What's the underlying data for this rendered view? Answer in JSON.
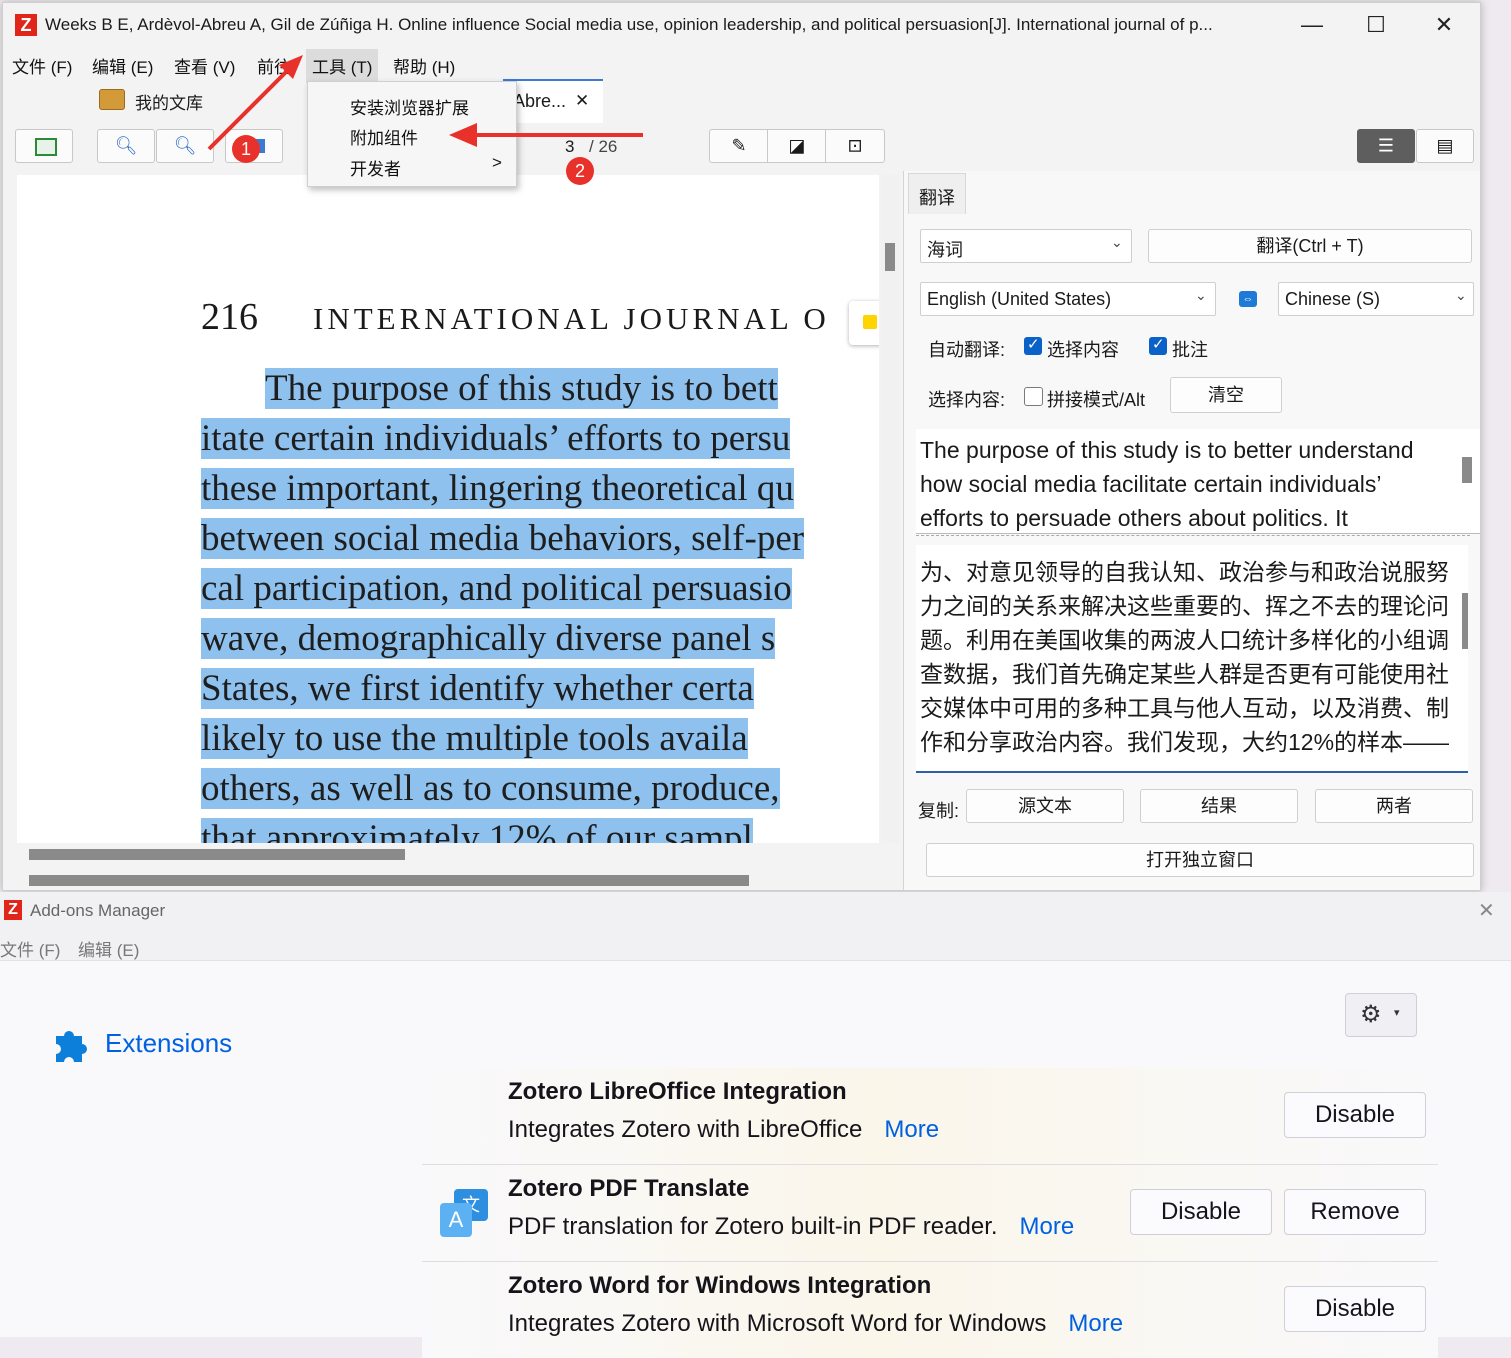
{
  "main_window": {
    "title": "Weeks B E, Ardèvol-Abreu A, Gil de Zúñiga H. Online influence Social media use, opinion leadership, and political persuasion[J]. International journal of p...",
    "logo": "Z",
    "controls": {
      "minimize": "—",
      "maximize": "☐",
      "close": "✕"
    }
  },
  "menubar": {
    "file": "文件 (F)",
    "edit": "编辑 (E)",
    "view": "查看 (V)",
    "go": "前往",
    "tools": "工具 (T)",
    "help": "帮助 (H)"
  },
  "tools_menu": {
    "items": [
      "安装浏览器扩展",
      "附加组件",
      "开发者"
    ],
    "submenu_arrow": ">"
  },
  "tabs": {
    "library": "我的文库",
    "reader_tab": "Abre...",
    "close": "✕"
  },
  "toolbar": {
    "page_current": "3",
    "page_total": "/ 26"
  },
  "annotations": {
    "badge1": "1",
    "badge2": "2"
  },
  "pdf": {
    "header_page": "216",
    "header_journal": "INTERNATIONAL JOURNAL O",
    "lines": [
      "The purpose of this study is to bett",
      "itate certain individuals’ efforts to persu",
      "these important, lingering theoretical qu",
      "between social media behaviors, self-per",
      "cal participation, and political persuasio",
      "wave, demographically diverse panel s",
      "States, we first identify whether certa",
      "likely to use the multiple tools availa",
      "others, as well as to consume, produce,",
      "that approximately 12% of our sampl"
    ]
  },
  "translate_panel": {
    "tab": "翻译",
    "engine": "海词",
    "translate_button": "翻译(Ctrl + T)",
    "source_lang": "English (United States)",
    "target_lang": "Chinese (S)",
    "auto_translate_label": "自动翻译:",
    "auto_selection": "选择内容",
    "auto_annotation": "批注",
    "selection_label": "选择内容:",
    "concat_mode": "拼接模式/Alt",
    "clear": "清空",
    "source_text": [
      "The purpose of this study is to better understand",
      "how social media facilitate certain individuals’",
      "efforts to persuade others about politics. It"
    ],
    "result_text": [
      "为、对意见领导的自我认知、政治参与和政治说服努",
      "力之间的关系来解决这些重要的、挥之不去的理论问",
      "题。利用在美国收集的两波人口统计多样化的小组调",
      "查数据，我们首先确定某些人群是否更有可能使用社",
      "交媒体中可用的多种工具与他人互动，以及消费、制",
      "作和分享政治内容。我们发现，大约12%的样本——"
    ],
    "copy_label": "复制:",
    "copy_source": "源文本",
    "copy_result": "结果",
    "copy_both": "两者",
    "open_window": "打开独立窗口"
  },
  "addons": {
    "title": "Add-ons Manager",
    "menu": {
      "file": "文件 (F)",
      "edit": "编辑 (E)"
    },
    "category": "Extensions",
    "items": [
      {
        "name": "Zotero LibreOffice Integration",
        "desc": "Integrates Zotero with LibreOffice",
        "more": "More",
        "buttons": [
          "Disable"
        ]
      },
      {
        "name": "Zotero PDF Translate",
        "desc": "PDF translation for Zotero built-in PDF reader.",
        "more": "More",
        "buttons": [
          "Disable",
          "Remove"
        ]
      },
      {
        "name": "Zotero Word for Windows Integration",
        "desc": "Integrates Zotero with Microsoft Word for Windows",
        "more": "More",
        "buttons": [
          "Disable"
        ]
      }
    ]
  },
  "colors": {
    "accent_red": "#e8312a",
    "link_blue": "#0061e0",
    "highlight": "#8ec1ee",
    "checkbox_blue": "#0a62c9"
  }
}
